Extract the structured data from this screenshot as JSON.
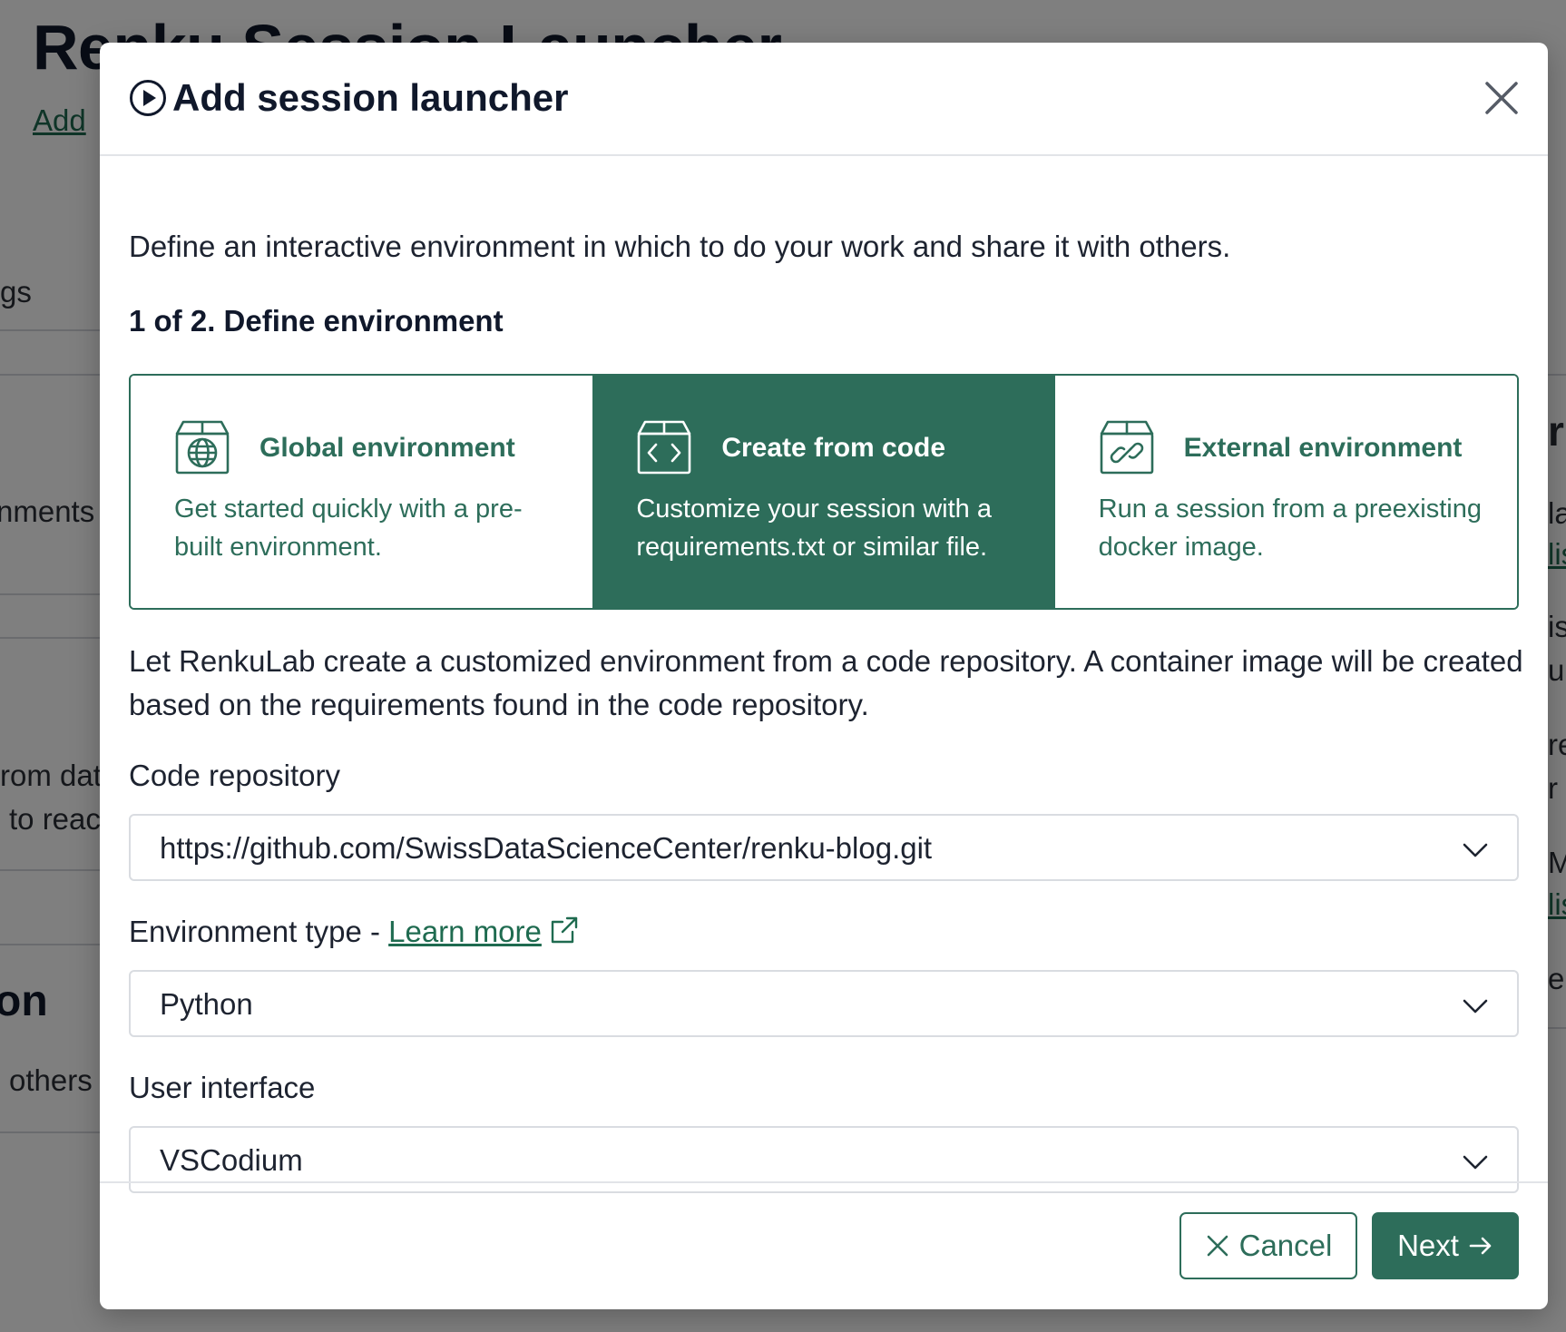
{
  "background": {
    "title": "Renku Session Launcher",
    "add_link": "Add",
    "fragments": [
      "gs",
      "nments",
      "rom dat",
      "to reac",
      "on",
      "others"
    ],
    "right_fragments": [
      "r",
      "la",
      "lis",
      "is",
      "u",
      "re",
      "r",
      "Me",
      "lis",
      "e"
    ]
  },
  "modal": {
    "title": "Add session launcher",
    "intro": "Define an interactive environment in which to do your work and share it with others.",
    "step": "1 of 2. Define environment",
    "options": [
      {
        "title": "Global environment",
        "description": "Get started quickly with a pre-built environment.",
        "icon": "globe-box-icon",
        "selected": false
      },
      {
        "title": "Create from code",
        "description": "Customize your session with a requirements.txt or similar file.",
        "icon": "code-box-icon",
        "selected": true
      },
      {
        "title": "External environment",
        "description": "Run a session from a preexisting docker image.",
        "icon": "link-box-icon",
        "selected": false
      }
    ],
    "env_description": "Let RenkuLab create a customized environment from a code repository. A container image will be created based on the requirements found in the code repository.",
    "code_repository": {
      "label": "Code repository",
      "value": "https://github.com/SwissDataScienceCenter/renku-blog.git"
    },
    "environment_type": {
      "label": "Environment type - ",
      "learn_more": "Learn more",
      "value": "Python"
    },
    "user_interface": {
      "label": "User interface",
      "value": "VSCodium"
    },
    "buttons": {
      "cancel": "Cancel",
      "next": "Next"
    }
  },
  "colors": {
    "accent": "#2d6d5a",
    "link": "#1f6b50",
    "text": "#1d2330",
    "overlay": "rgba(0,0,0,0.5)"
  }
}
